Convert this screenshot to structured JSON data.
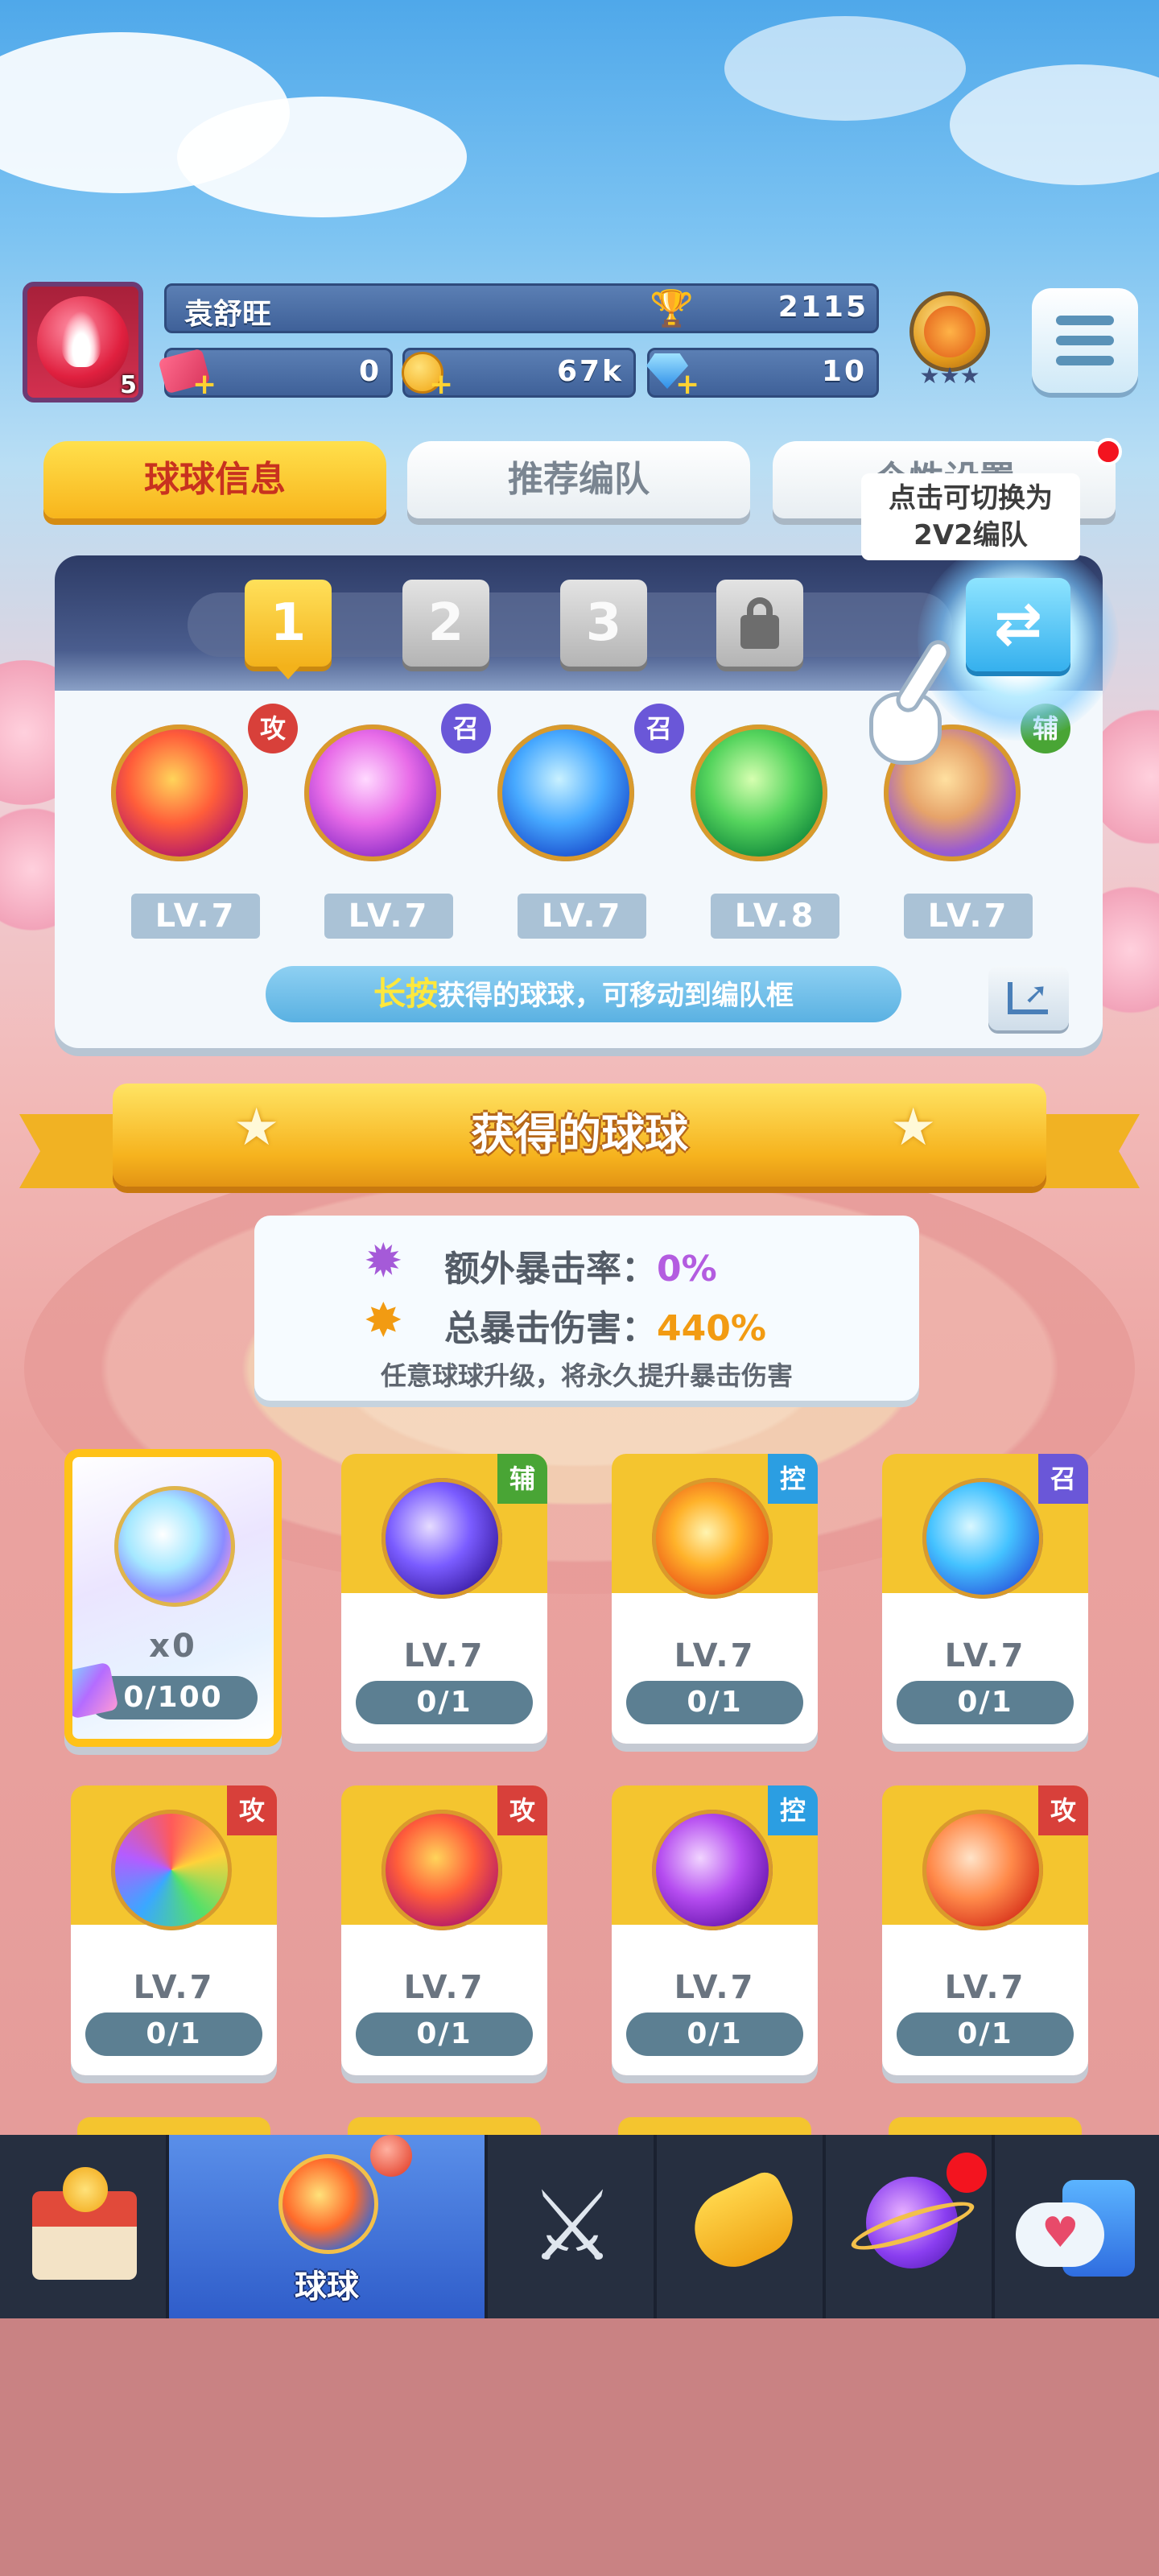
{
  "player": {
    "name": "袁舒旺",
    "level": "5",
    "trophies": "2115",
    "tickets": "0",
    "coins": "67k",
    "gems": "10"
  },
  "tabs": [
    {
      "label": "球球信息",
      "active": true
    },
    {
      "label": "推荐编队",
      "active": false
    },
    {
      "label": "个性设置",
      "active": false
    }
  ],
  "team": {
    "slots": [
      "1",
      "2",
      "3"
    ],
    "tooltip_line1": "点击可切换为",
    "tooltip_line2": "2V2编队",
    "members": [
      {
        "tag": "攻",
        "level": "LV.7"
      },
      {
        "tag": "召",
        "level": "LV.7"
      },
      {
        "tag": "召",
        "level": "LV.7"
      },
      {
        "tag": "",
        "level": "LV.8"
      },
      {
        "tag": "辅",
        "level": "LV.7"
      }
    ],
    "hint_highlight": "长按",
    "hint_text": "获得的球球，可移动到编队框"
  },
  "owned": {
    "title": "获得的球球",
    "extra_crit_label": "额外暴击率：",
    "extra_crit_value": "0%",
    "total_crit_label": "总暴击伤害：",
    "total_crit_value": "440%",
    "note": "任意球球升级，将永久提升暴击伤害"
  },
  "cards": [
    {
      "tag": "",
      "level": "x0",
      "progress": "0/100"
    },
    {
      "tag": "辅",
      "level": "LV.7",
      "progress": "0/1"
    },
    {
      "tag": "控",
      "level": "LV.7",
      "progress": "0/1"
    },
    {
      "tag": "召",
      "level": "LV.7",
      "progress": "0/1"
    },
    {
      "tag": "攻",
      "level": "LV.7",
      "progress": "0/1"
    },
    {
      "tag": "攻",
      "level": "LV.7",
      "progress": "0/1"
    },
    {
      "tag": "控",
      "level": "LV.7",
      "progress": "0/1"
    },
    {
      "tag": "攻",
      "level": "LV.7",
      "progress": "0/1"
    }
  ],
  "nav": {
    "items": [
      "shop-icon",
      "ball-icon",
      "battle-icon",
      "whistle-icon",
      "planet-icon",
      "chat-icon"
    ],
    "active_label": "球球"
  },
  "colors": {
    "tag_attack": "#d8403a",
    "tag_summon": "#6a57d8",
    "tag_control": "#2b9ee2",
    "tag_support": "#49a535"
  }
}
